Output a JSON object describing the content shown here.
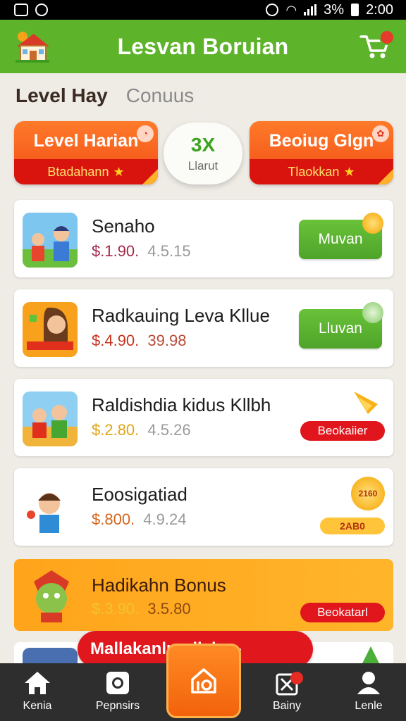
{
  "status_bar": {
    "battery": "3%",
    "time": "2:00"
  },
  "header": {
    "title": "Lesvan Boruian"
  },
  "tabs": [
    {
      "label": "Level Hay",
      "active": true
    },
    {
      "label": "Conuus",
      "active": false
    }
  ],
  "promo": {
    "left": {
      "title": "Level Harian",
      "subtitle": "Btadahann"
    },
    "center": {
      "value": "3X",
      "label": "Llarut"
    },
    "right": {
      "title": "Beoiug Glgn",
      "subtitle": "Tlaokkan"
    }
  },
  "products": [
    {
      "name": "Senaho",
      "price": "$.1.90.",
      "old_price": "4.5.15",
      "action": "Muvan"
    },
    {
      "name": "Radkauing Leva Kllue",
      "price": "$.4.90.",
      "old_price": "39.98",
      "action": "Lluvan"
    },
    {
      "name": "Raldishdia kidus Kllbh",
      "price": "$.2.80.",
      "old_price": "4.5.26",
      "action": "Beokaiier"
    },
    {
      "name": "Eoosigatiad",
      "price": "$.800.",
      "old_price": "4.9.24",
      "badge": "2160",
      "coin_badge": "2AB0"
    }
  ],
  "bonus": {
    "name": "Hadikahn Bonus",
    "price": "$.3.90.",
    "old_price": "3.5.80",
    "action": "Beokatarl"
  },
  "banner": {
    "text": "Mallakanlu· diabx -"
  },
  "bottom_nav": [
    {
      "label": "Kenia"
    },
    {
      "label": "Pepnsirs"
    },
    {
      "label": "Bainy"
    },
    {
      "label": "Lenle"
    }
  ],
  "colors": {
    "brand_green": "#5db329",
    "accent_orange": "#f2620b",
    "accent_red": "#e0161c"
  }
}
